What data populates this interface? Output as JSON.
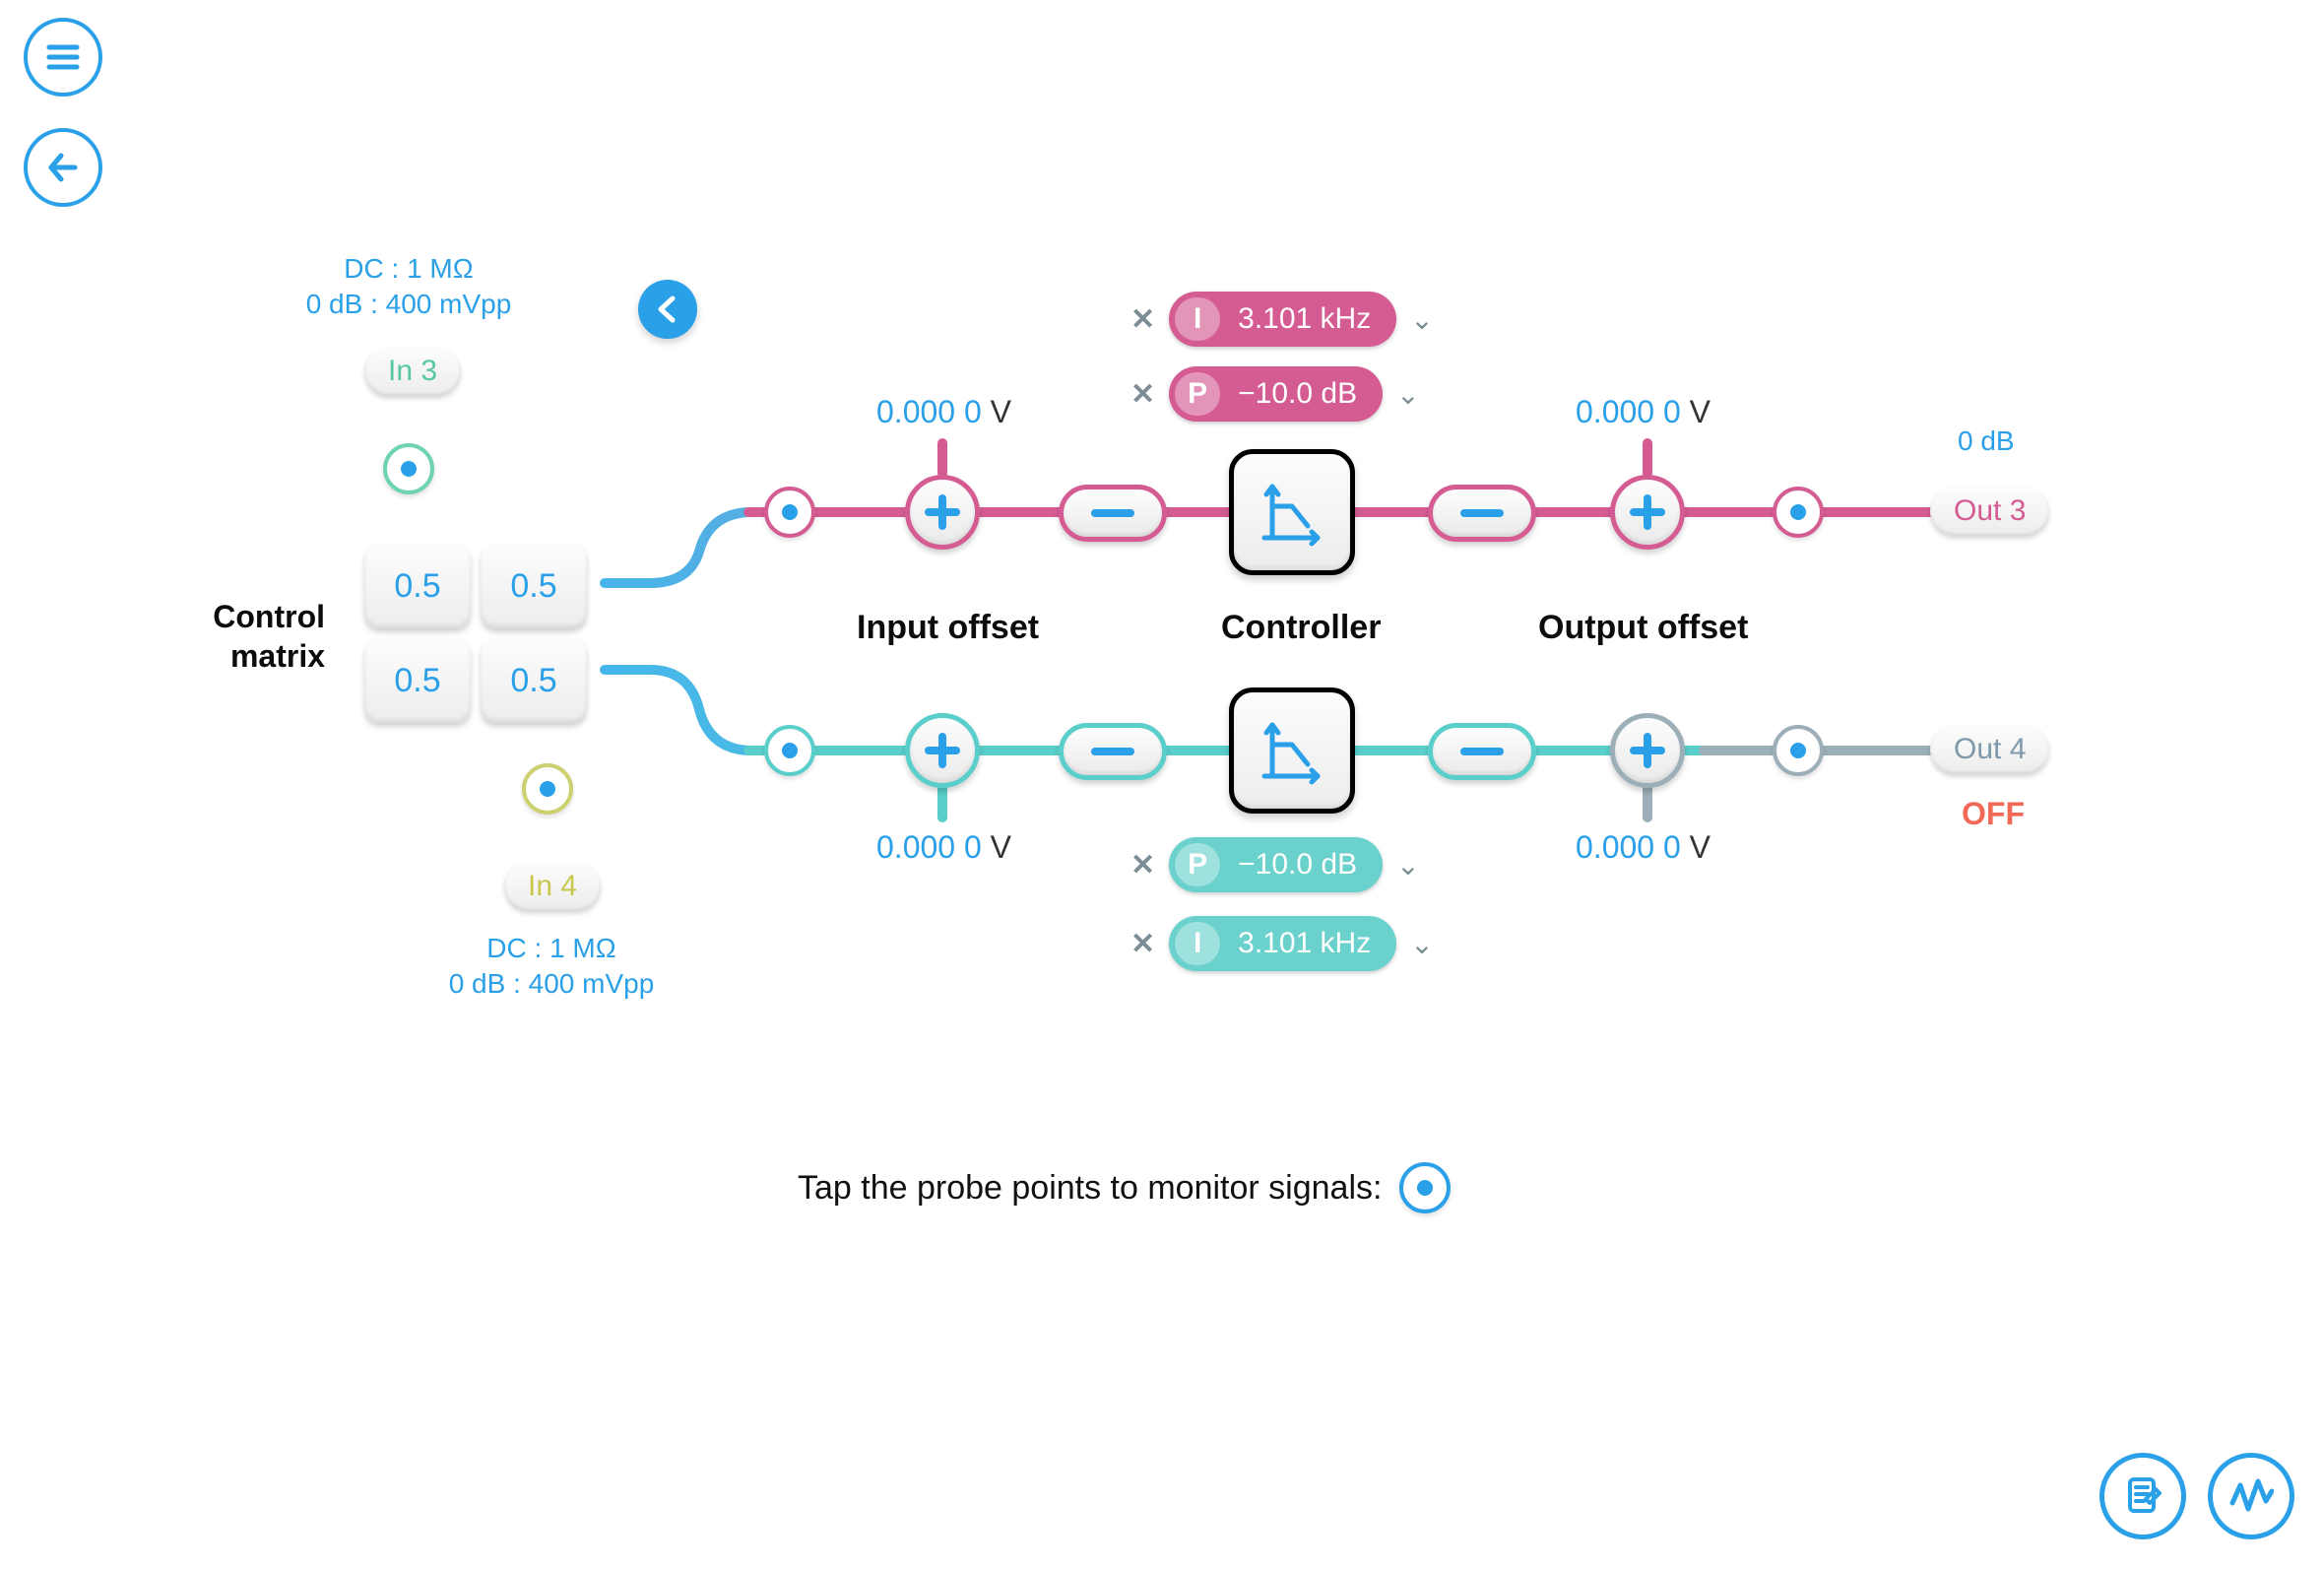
{
  "inputs": {
    "in3": {
      "label": "In 3",
      "info_l1": "DC : 1 MΩ",
      "info_l2": "0 dB : 400 mVpp"
    },
    "in4": {
      "label": "In 4",
      "info_l1": "DC : 1 MΩ",
      "info_l2": "0 dB : 400 mVpp"
    }
  },
  "outputs": {
    "out3": {
      "label": "Out 3",
      "gain": "0 dB"
    },
    "out4": {
      "label": "Out 4",
      "state": "OFF"
    }
  },
  "matrix": {
    "label": "Control\nmatrix",
    "cells": [
      "0.5",
      "0.5",
      "0.5",
      "0.5"
    ]
  },
  "sections": {
    "input_offset": "Input offset",
    "controller": "Controller",
    "output_offset": "Output offset"
  },
  "chain_top": {
    "input_offset": {
      "value": "0.000 0",
      "unit": "V"
    },
    "output_offset": {
      "value": "0.000 0",
      "unit": "V"
    },
    "params": {
      "I": {
        "tag": "I",
        "value": "3.101 kHz"
      },
      "P": {
        "tag": "P",
        "value": "−10.0 dB"
      }
    }
  },
  "chain_bottom": {
    "input_offset": {
      "value": "0.000 0",
      "unit": "V"
    },
    "output_offset": {
      "value": "0.000 0",
      "unit": "V"
    },
    "params": {
      "P": {
        "tag": "P",
        "value": "−10.0 dB"
      },
      "I": {
        "tag": "I",
        "value": "3.101 kHz"
      }
    }
  },
  "hint": "Tap the probe points to monitor signals:"
}
